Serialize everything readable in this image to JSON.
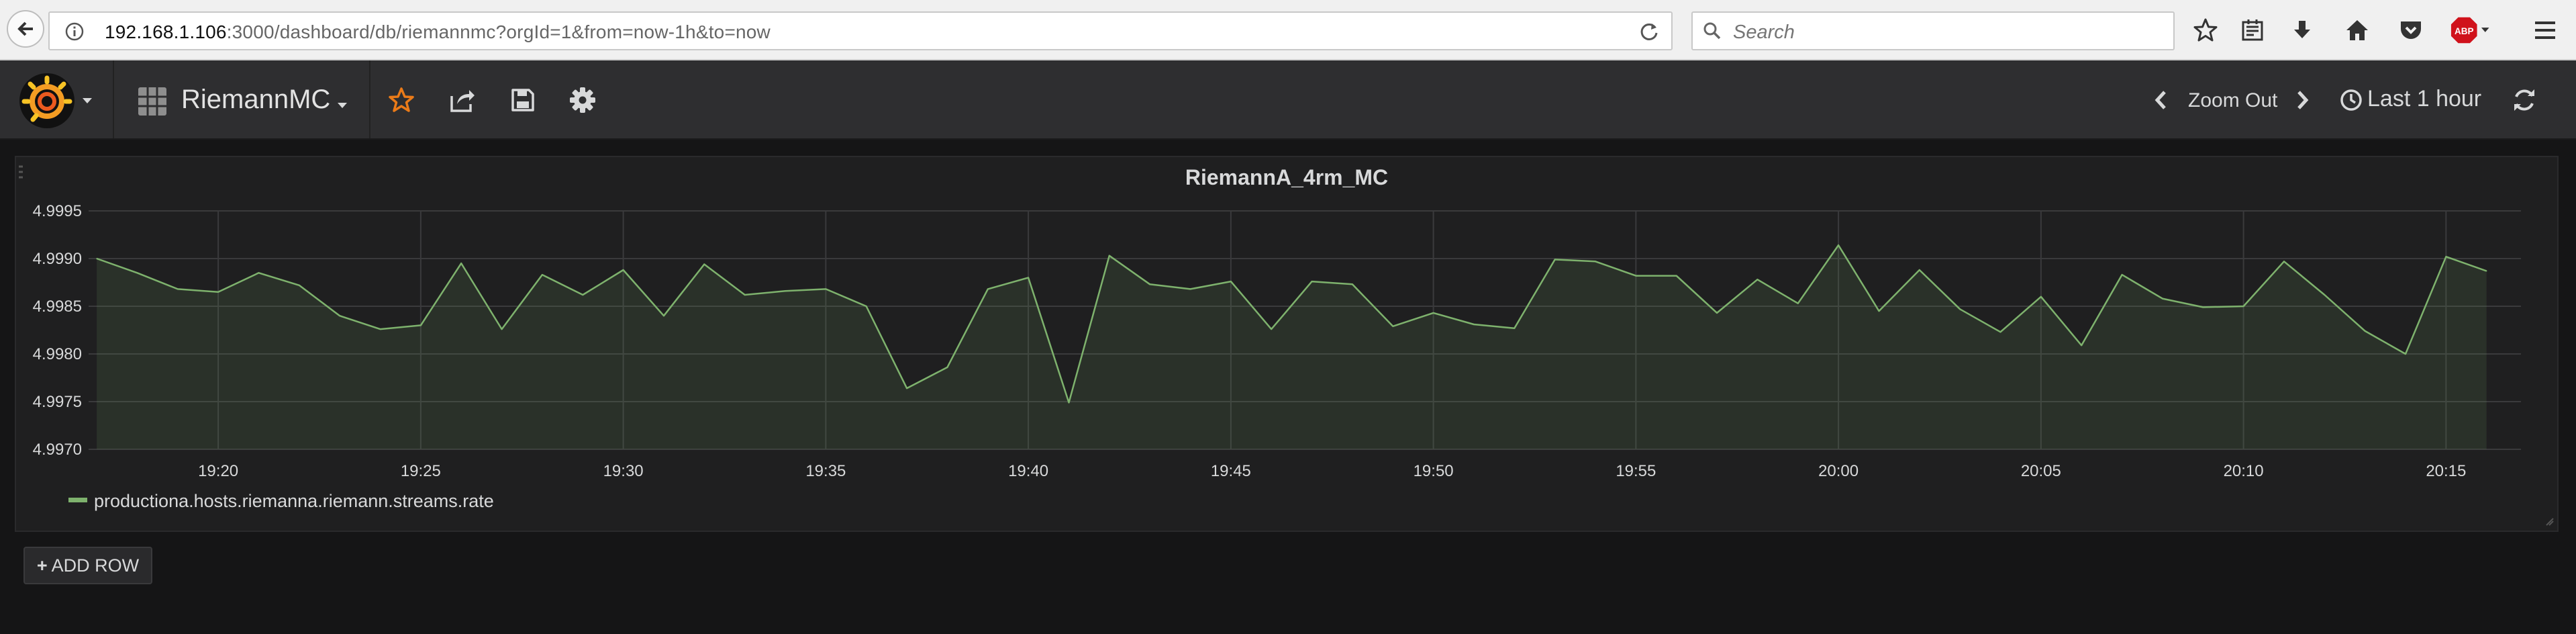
{
  "browser": {
    "url_host": "192.168.1.106",
    "url_rest": ":3000/dashboard/db/riemannmc?orgId=1&from=now-1h&to=now",
    "search_placeholder": "Search",
    "adblock_badge": "ABP",
    "icons": [
      "back-arrow-icon",
      "info-icon",
      "reload-icon",
      "search-icon",
      "bookmark-star-icon",
      "reading-list-icon",
      "download-icon",
      "home-icon",
      "pocket-icon",
      "adblock-icon",
      "menu-icon"
    ]
  },
  "topnav": {
    "dashboard_title": "RiemannMC",
    "zoom_out": "Zoom Out",
    "time_range": "Last 1 hour",
    "icons": [
      "grafana-logo-icon",
      "dashboards-grid-icon",
      "star-icon",
      "share-icon",
      "save-icon",
      "gear-icon",
      "chevron-left-icon",
      "chevron-right-icon",
      "clock-icon",
      "refresh-icon"
    ],
    "accent_color": "#eb7b18"
  },
  "panel": {
    "title": "RiemannA_4rm_MC",
    "legend": "productiona.hosts.riemanna.riemann.streams.rate"
  },
  "add_row": {
    "label": "ADD ROW"
  },
  "chart_data": {
    "type": "area",
    "title": "RiemannA_4rm_MC",
    "xlabel": "",
    "ylabel": "",
    "ylim": [
      4.997,
      4.9995
    ],
    "yticks": [
      "4.9995",
      "4.9990",
      "4.9985",
      "4.9980",
      "4.9975",
      "4.9970"
    ],
    "xticks": [
      "19:20",
      "19:25",
      "19:30",
      "19:35",
      "19:40",
      "19:45",
      "19:50",
      "19:55",
      "20:00",
      "20:05",
      "20:10",
      "20:15"
    ],
    "grid": true,
    "legend_position": "bottom-left",
    "series": [
      {
        "name": "productiona.hosts.riemanna.riemann.streams.rate",
        "color": "#7eb26d",
        "x": [
          "19:17",
          "19:18",
          "19:19",
          "19:20",
          "19:21",
          "19:22",
          "19:23",
          "19:24",
          "19:25",
          "19:26",
          "19:27",
          "19:28",
          "19:29",
          "19:30",
          "19:31",
          "19:32",
          "19:33",
          "19:34",
          "19:35",
          "19:36",
          "19:37",
          "19:38",
          "19:39",
          "19:40",
          "19:41",
          "19:42",
          "19:43",
          "19:44",
          "19:45",
          "19:46",
          "19:47",
          "19:48",
          "19:49",
          "19:50",
          "19:51",
          "19:52",
          "19:53",
          "19:54",
          "19:55",
          "19:56",
          "19:57",
          "19:58",
          "19:59",
          "20:00",
          "20:01",
          "20:02",
          "20:03",
          "20:04",
          "20:05",
          "20:06",
          "20:07",
          "20:08",
          "20:09",
          "20:10",
          "20:11",
          "20:12",
          "20:13",
          "20:14",
          "20:15",
          "20:16"
        ],
        "values": [
          4.999,
          4.99885,
          4.99868,
          4.99865,
          4.99885,
          4.99872,
          4.9984,
          4.99826,
          4.9983,
          4.99895,
          4.99826,
          4.99883,
          4.99862,
          4.99888,
          4.9984,
          4.99894,
          4.99862,
          4.99866,
          4.99868,
          4.9985,
          4.99764,
          4.99786,
          4.99868,
          4.9988,
          4.99749,
          4.99903,
          4.99873,
          4.99868,
          4.99876,
          4.99826,
          4.99876,
          4.99873,
          4.99829,
          4.99843,
          4.99831,
          4.99827,
          4.99899,
          4.99897,
          4.99882,
          4.99882,
          4.99843,
          4.99878,
          4.99853,
          4.99914,
          4.99845,
          4.99888,
          4.99847,
          4.99823,
          4.9986,
          4.99809,
          4.99883,
          4.99858,
          4.99849,
          4.9985,
          4.99897,
          4.99862,
          4.99824,
          4.998,
          4.99902,
          4.99887
        ]
      }
    ]
  }
}
